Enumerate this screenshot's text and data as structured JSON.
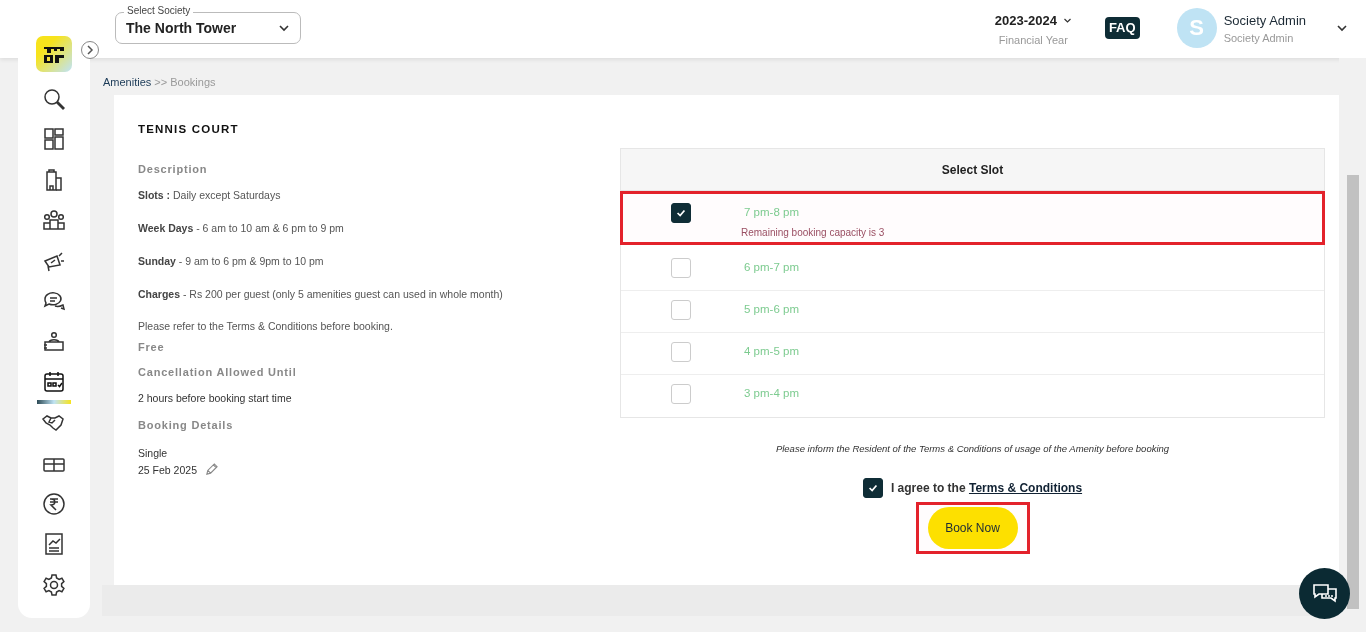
{
  "header": {
    "society_select": {
      "label": "Select Society",
      "value": "The North Tower"
    },
    "financial_year": {
      "value": "2023-2024",
      "label": "Financial Year"
    },
    "faq": "FAQ",
    "user": {
      "initial": "S",
      "name": "Society Admin",
      "role": "Society Admin"
    }
  },
  "sidebar": {
    "items": [
      {
        "selected": false
      },
      {
        "selected": false
      },
      {
        "selected": false
      },
      {
        "selected": false
      },
      {
        "selected": false
      },
      {
        "selected": false
      },
      {
        "selected": false
      },
      {
        "selected": true
      },
      {
        "selected": false
      },
      {
        "selected": false
      },
      {
        "selected": false
      },
      {
        "selected": false
      },
      {
        "selected": false
      }
    ]
  },
  "breadcrumb": {
    "parent": "Amenities",
    "current": ">> Bookings"
  },
  "amenity": {
    "title": "TENNIS COURT",
    "description_heading": "Description",
    "details": [
      "**Slots :** Daily except Saturdays",
      "**Week Days** - 6 am to 10 am & 6 pm to 9 pm",
      "**Sunday** - 9 am to 6 pm & 9pm to 10 pm",
      "**Charges** - Rs 200 per guest (only 5 amenities guest can used in whole month)"
    ],
    "note": "Please refer to the Terms & Conditions before booking.",
    "charge_type": "Free",
    "cancellation_heading": "Cancellation Allowed Until",
    "cancellation": "2 hours before booking start time",
    "booking_heading": "Booking Details",
    "booking_type": "Single",
    "booking_date": "25 Feb 2025"
  },
  "slots": {
    "heading": "Select Slot",
    "rows": [
      {
        "time": "7 pm-8 pm",
        "checked": true,
        "highlighted": true,
        "capacity": "Remaining booking capacity is 3"
      },
      {
        "time": "6 pm-7 pm",
        "checked": false,
        "highlighted": false
      },
      {
        "time": "5 pm-6 pm",
        "checked": false,
        "highlighted": false
      },
      {
        "time": "4 pm-5 pm",
        "checked": false,
        "highlighted": false
      },
      {
        "time": "3 pm-4 pm",
        "checked": false,
        "highlighted": false
      }
    ]
  },
  "inform_note": "Please inform the Resident of the Terms & Conditions of usage of the Amenity before booking",
  "agreement": {
    "checked": true,
    "text": "I agree to the",
    "link": "Terms & Conditions"
  },
  "book_button": {
    "label": "Book Now",
    "highlighted": true
  }
}
